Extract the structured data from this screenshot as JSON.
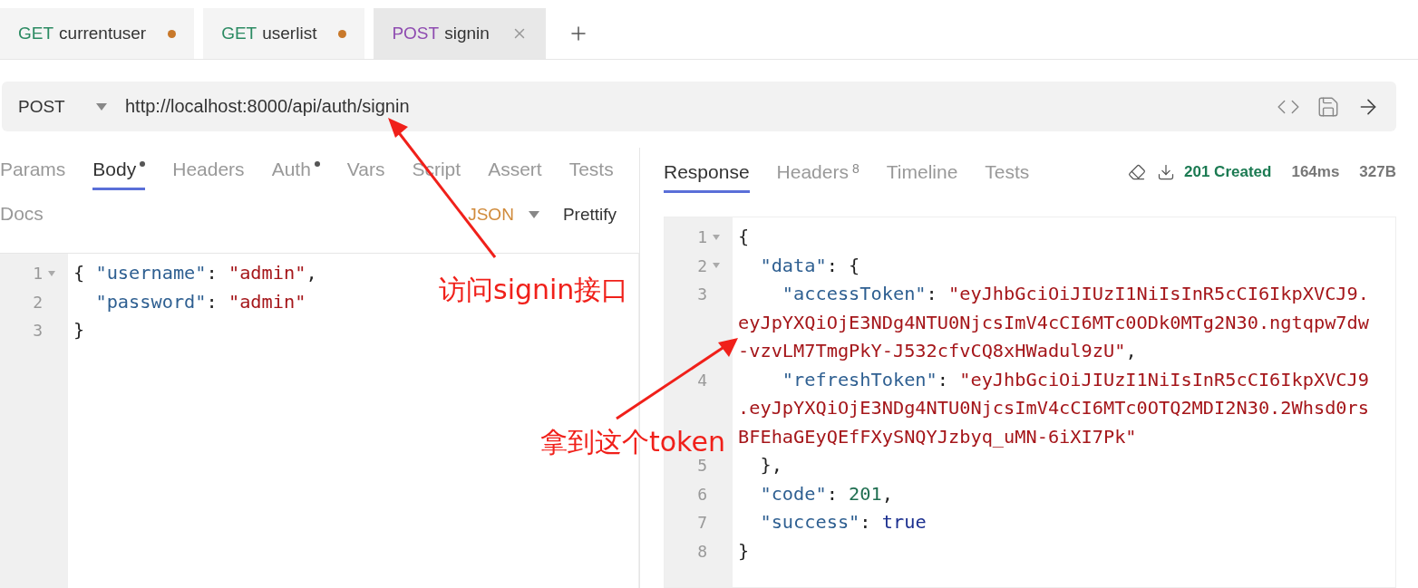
{
  "tabs": [
    {
      "method": "GET",
      "color": "#2b8a62",
      "name": "currentuser",
      "selected": false,
      "unsaved": true
    },
    {
      "method": "GET",
      "color": "#2b8a62",
      "name": "userlist",
      "selected": false,
      "unsaved": true
    },
    {
      "method": "POST",
      "color": "#8e4bb0",
      "name": "signin",
      "selected": true,
      "unsaved": false
    }
  ],
  "request": {
    "method": "POST",
    "url": "http://localhost:8000/api/auth/signin"
  },
  "request_tabs": [
    {
      "label": "Params",
      "selected": false,
      "modified": false
    },
    {
      "label": "Body",
      "selected": true,
      "modified": true
    },
    {
      "label": "Headers",
      "selected": false,
      "modified": false
    },
    {
      "label": "Auth",
      "selected": false,
      "modified": true
    },
    {
      "label": "Vars",
      "selected": false,
      "modified": false
    },
    {
      "label": "Script",
      "selected": false,
      "modified": false
    },
    {
      "label": "Assert",
      "selected": false,
      "modified": false
    },
    {
      "label": "Tests",
      "selected": false,
      "modified": false
    },
    {
      "label": "Docs",
      "selected": false,
      "modified": false
    }
  ],
  "body_mode": "JSON",
  "prettify": "Prettify",
  "request_body": [
    {
      "number": "1",
      "fold": true,
      "tokens": [
        {
          "kind": "punct",
          "text": "{ "
        },
        {
          "kind": "key",
          "text": "\"username\""
        },
        {
          "kind": "punct",
          "text": ": "
        },
        {
          "kind": "string",
          "text": "\"admin\""
        },
        {
          "kind": "punct",
          "text": ","
        }
      ]
    },
    {
      "number": "2",
      "fold": false,
      "tokens": [
        {
          "kind": "key",
          "text": "  \"password\""
        },
        {
          "kind": "punct",
          "text": ": "
        },
        {
          "kind": "string",
          "text": "\"admin\""
        }
      ]
    },
    {
      "number": "3",
      "fold": false,
      "tokens": [
        {
          "kind": "punct",
          "text": "}"
        }
      ]
    }
  ],
  "response_tabs": [
    {
      "label": "Response",
      "selected": true
    },
    {
      "label": "Headers",
      "badge": "8",
      "selected": false
    },
    {
      "label": "Timeline",
      "selected": false
    },
    {
      "label": "Tests",
      "selected": false
    }
  ],
  "status": "201 Created",
  "time": "164ms",
  "size": "327B",
  "response_body": [
    {
      "number": "1",
      "fold": true,
      "tokens": [
        {
          "kind": "punct",
          "text": "{"
        }
      ]
    },
    {
      "number": "2",
      "fold": true,
      "tokens": [
        {
          "kind": "key",
          "text": "  \"data\""
        },
        {
          "kind": "punct",
          "text": ": {"
        }
      ]
    },
    {
      "number": "3",
      "fold": false,
      "tokens": [
        {
          "kind": "key",
          "text": "    \"accessToken\""
        },
        {
          "kind": "punct",
          "text": ": "
        },
        {
          "kind": "string",
          "text": "\"eyJhbGciOiJIUzI1NiIsInR5cCI6IkpXVCJ9."
        }
      ]
    },
    {
      "fold": false,
      "tokens": [
        {
          "kind": "string",
          "text": "eyJpYXQiOjE3NDg4NTU0NjcsImV4cCI6MTc0ODk0MTg2N30.ngtqpw7dw"
        }
      ]
    },
    {
      "fold": false,
      "tokens": [
        {
          "kind": "string",
          "text": "-vzvLM7TmgPkY-J532cfvCQ8xHWadul9zU\""
        },
        {
          "kind": "punct",
          "text": ","
        }
      ]
    },
    {
      "number": "4",
      "fold": false,
      "tokens": [
        {
          "kind": "key",
          "text": "    \"refreshToken\""
        },
        {
          "kind": "punct",
          "text": ": "
        },
        {
          "kind": "string",
          "text": "\"eyJhbGciOiJIUzI1NiIsInR5cCI6IkpXVCJ9"
        }
      ]
    },
    {
      "fold": false,
      "tokens": [
        {
          "kind": "string",
          "text": ".eyJpYXQiOjE3NDg4NTU0NjcsImV4cCI6MTc0OTQ2MDI2N30.2Whsd0rs"
        }
      ]
    },
    {
      "fold": false,
      "tokens": [
        {
          "kind": "string",
          "text": "BFEhaGEyQEfFXySNQYJzbyq_uMN-6iXI7Pk\""
        }
      ]
    },
    {
      "number": "5",
      "fold": false,
      "tokens": [
        {
          "kind": "punct",
          "text": "  },"
        }
      ]
    },
    {
      "number": "6",
      "fold": false,
      "tokens": [
        {
          "kind": "key",
          "text": "  \"code\""
        },
        {
          "kind": "punct",
          "text": ": "
        },
        {
          "kind": "number",
          "text": "201"
        },
        {
          "kind": "punct",
          "text": ","
        }
      ]
    },
    {
      "number": "7",
      "fold": false,
      "tokens": [
        {
          "kind": "key",
          "text": "  \"success\""
        },
        {
          "kind": "punct",
          "text": ": "
        },
        {
          "kind": "bool",
          "text": "true"
        }
      ]
    },
    {
      "number": "8",
      "fold": false,
      "tokens": [
        {
          "kind": "punct",
          "text": "}"
        }
      ]
    }
  ],
  "annotations": [
    {
      "text": "访问signin接口"
    },
    {
      "text": "拿到这个token"
    }
  ]
}
